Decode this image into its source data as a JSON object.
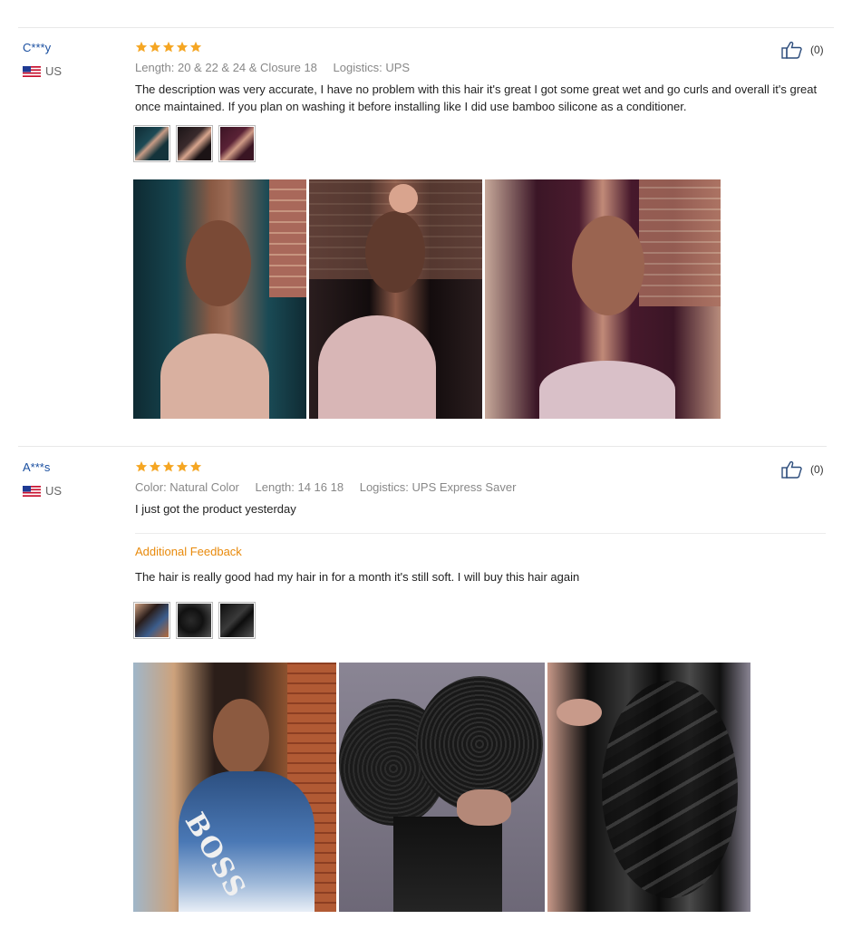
{
  "colors": {
    "star": "#f5a623",
    "name": "#1a4fa0",
    "feedback_title": "#e88a0c",
    "meta": "#888888"
  },
  "reviews": [
    {
      "user": "C***y",
      "country": "US",
      "flag_icon": "us-flag-icon",
      "rating": 5,
      "likes": "(0)",
      "meta": {
        "length": "Length: 20 & 22 & 24 & Closure 18",
        "logistics": "Logistics: UPS"
      },
      "text": "The description was very accurate, I have no problem with this hair it's great I got some great wet and go curls and overall it's great once maintained. If you plan on washing it before installing like I did use bamboo silicone as a conditioner.",
      "thumbnails": [
        "review-photo-thumbnail",
        "review-photo-thumbnail",
        "review-photo-thumbnail"
      ],
      "photos": [
        "customer-photo-wavy-hair",
        "customer-photo-wavy-hair",
        "customer-photo-wavy-hair"
      ]
    },
    {
      "user": "A***s",
      "country": "US",
      "flag_icon": "us-flag-icon",
      "rating": 5,
      "likes": "(0)",
      "meta": {
        "color": "Color: Natural Color",
        "length": "Length: 14 16 18",
        "logistics": "Logistics: UPS Express Saver"
      },
      "text": "I just got the product yesterday",
      "additional_feedback_title": "Additional Feedback",
      "additional_feedback_text": "The hair is really good had my hair in for a month it's still soft. I will buy this hair again",
      "thumbnails": [
        "review-photo-thumbnail",
        "review-photo-thumbnail",
        "review-photo-thumbnail"
      ],
      "photos": [
        "customer-photo-curly-hair",
        "customer-photo-hair-bundles",
        "customer-photo-body-wave"
      ],
      "photo_text": "BOSS"
    }
  ]
}
